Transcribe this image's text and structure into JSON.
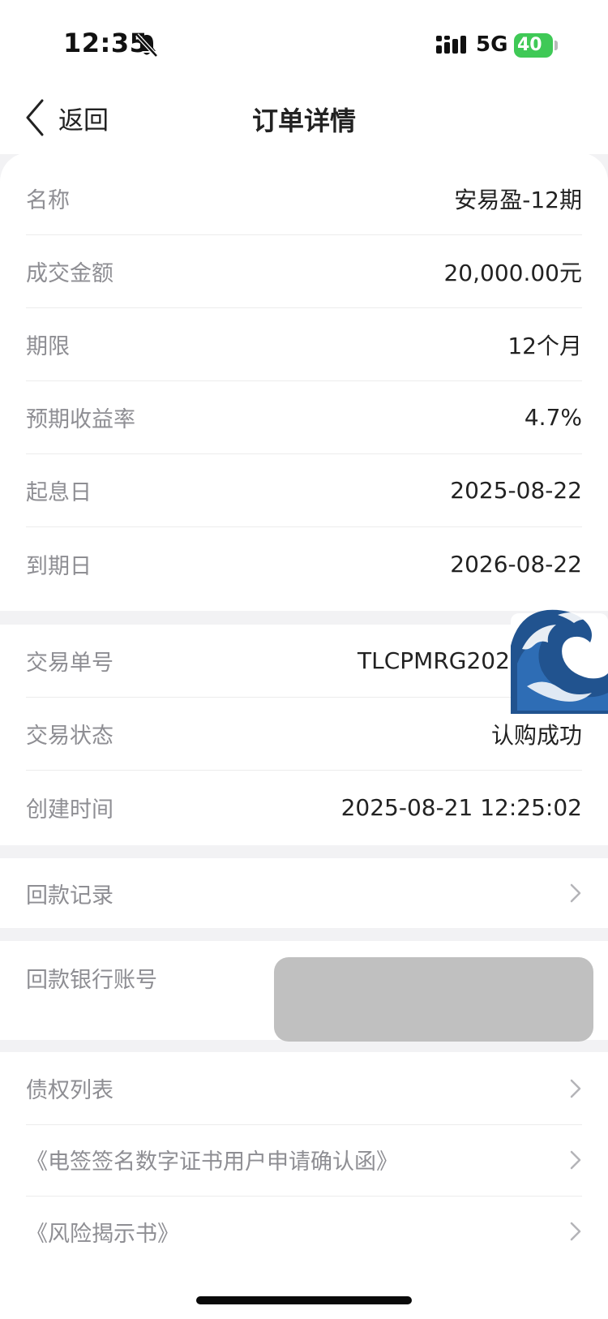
{
  "status": {
    "time": "12:35",
    "network": "5G",
    "battery": "40"
  },
  "nav": {
    "back_label": "返回",
    "title": "订单详情"
  },
  "details": {
    "name_label": "名称",
    "name_value": "安易盈-12期",
    "amount_label": "成交金额",
    "amount_value": "20,000.00元",
    "term_label": "期限",
    "term_value": "12个月",
    "rate_label": "预期收益率",
    "rate_value": "4.7%",
    "start_label": "起息日",
    "start_value": "2025-08-22",
    "end_label": "到期日",
    "end_value": "2026-08-22"
  },
  "transaction": {
    "no_label": "交易单号",
    "no_value": "TLCPMRG20250821",
    "status_label": "交易状态",
    "status_value": "认购成功",
    "created_label": "创建时间",
    "created_value": "2025-08-21 12:25:02"
  },
  "repayment": {
    "records_label": "回款记录",
    "bank_label": "回款银行账号"
  },
  "documents": {
    "claims_label": "债权列表",
    "cert_label": "《电签签名数字证书用户申请确认函》",
    "risk_label": "《风险揭示书》"
  },
  "icons": {
    "mute": "bell-slash-icon",
    "signal": "cellular-signal-icon",
    "back": "chevron-left-icon",
    "chevron": "chevron-right-icon",
    "sticker": "water-wave-emoji-icon"
  },
  "colors": {
    "background": "#f2f2f4",
    "label": "#8e8e93",
    "battery": "#3fc956",
    "mask": "#c0c0c0"
  }
}
